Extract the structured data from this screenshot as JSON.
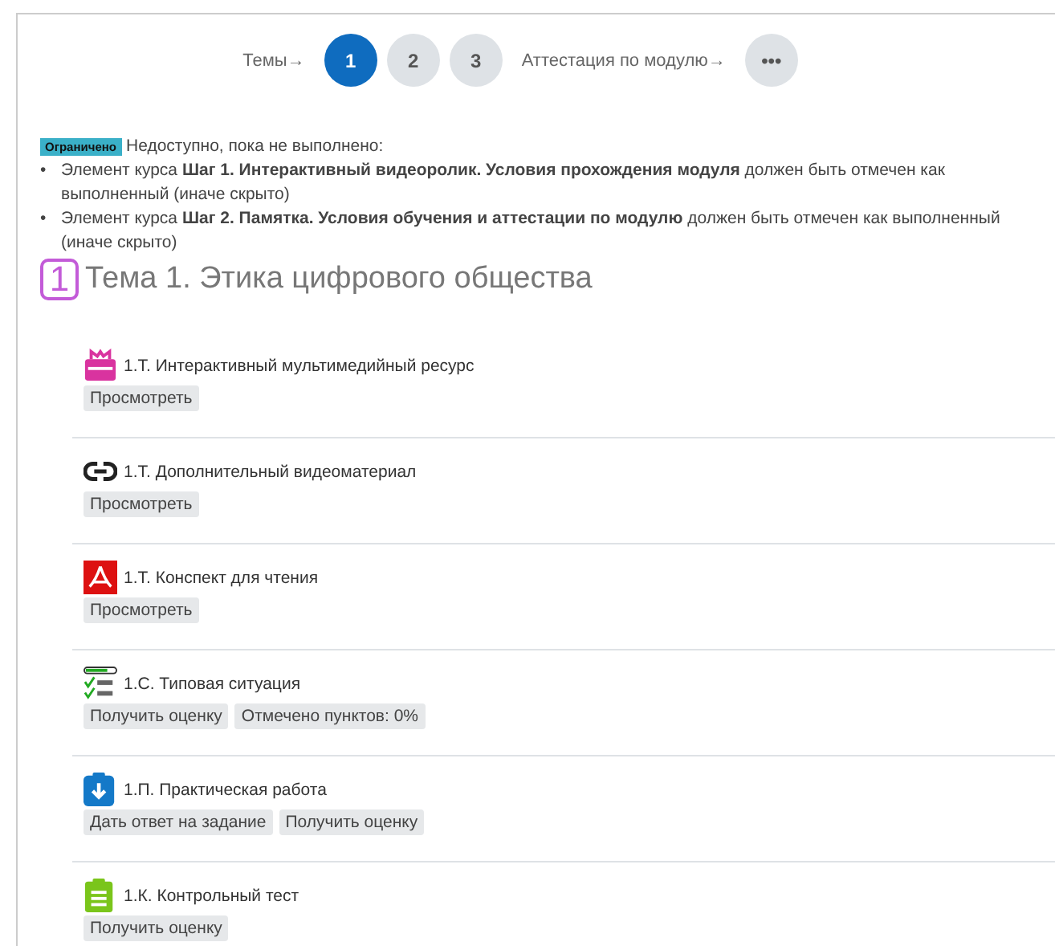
{
  "nav": [
    {
      "kind": "label",
      "text": "Темы→"
    },
    {
      "kind": "circle",
      "text": "1",
      "selected": true
    },
    {
      "kind": "circle",
      "text": "2",
      "selected": false
    },
    {
      "kind": "circle",
      "text": "3",
      "selected": false
    },
    {
      "kind": "label",
      "text": "Аттестация по модулю→"
    },
    {
      "kind": "circle",
      "text": "•••",
      "selected": false
    }
  ],
  "restriction": {
    "badge": "Ограничено",
    "intro": "Недоступно, пока не выполнено:",
    "conditions": [
      {
        "bullet": "•",
        "text": "Элемент курса **Шаг 1. Интерактивный видеоролик. Условия прохождения модуля** должен быть отмечен как выполненный (иначе скрыто)"
      },
      {
        "bullet": "•",
        "text": "Элемент курса **Шаг 2. Памятка. Условия обучения и аттестации по модулю** должен быть отмечен как выполненный (иначе скрыто)"
      }
    ]
  },
  "section": {
    "number": "1",
    "title": "Тема 1. Этика цифрового общества"
  },
  "activities": [
    {
      "kind": "interactive",
      "title": "1.Т. Интерактивный мультимедийный ресурс",
      "buttons": [
        "Просмотреть"
      ]
    },
    {
      "kind": "url",
      "title": "1.Т. Дополнительный видеоматериал",
      "buttons": [
        "Просмотреть"
      ]
    },
    {
      "kind": "pdf",
      "title": "1.Т. Конспект для чтения",
      "buttons": [
        "Просмотреть"
      ]
    },
    {
      "kind": "checklist",
      "title": "1.С. Типовая ситуация",
      "buttons": [
        "Получить оценку",
        "Отмечено пунктов: 0%"
      ]
    },
    {
      "kind": "assign",
      "title": "1.П. Практическая работа",
      "buttons": [
        "Дать ответ на задание",
        "Получить оценку"
      ]
    },
    {
      "kind": "quiz",
      "title": "1.К. Контрольный тест",
      "buttons": [
        "Получить оценку"
      ]
    }
  ]
}
